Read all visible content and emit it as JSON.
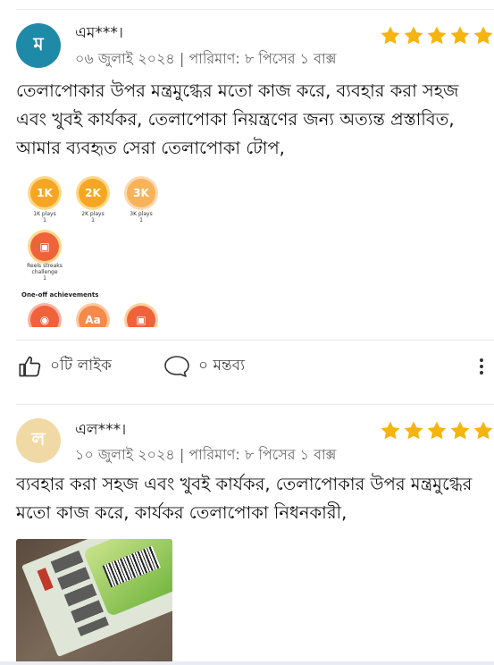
{
  "reviews": [
    {
      "avatar_letter": "ম",
      "avatar_color": "#1f8aa8",
      "name": "এম***।",
      "meta": "০৬ জুলাই ২০২৪ | পারিমাণ: ৮ পিসের ১ বাক্স",
      "rating": 5,
      "text": "তেলাপোকার উপর মন্ত্রমুগ্ধের মতো কাজ করে, ব্যবহার করা সহজ এবং খুবই কার্যকর, তেলাপোকা নিয়ন্ত্রণের জন্য অত্যন্ত প্রস্তাবিত, আমার ব্যবহৃত সেরা তেলাপোকা টোপ,",
      "image": {
        "badges": [
          {
            "label": "1K",
            "caption": "1K plays",
            "count": "1"
          },
          {
            "label": "2K",
            "caption": "2K plays",
            "count": "1"
          },
          {
            "label": "3K",
            "caption": "3K plays",
            "count": "1"
          }
        ],
        "streak_caption": "Reels streaks challenge",
        "streak_count": "1",
        "section_title": "One-off achievements",
        "aa_label": "Aa"
      },
      "likes_label": "০টি লাইক",
      "comments_label": "০ মন্তব্য"
    },
    {
      "avatar_letter": "ল",
      "avatar_color": "#f1d9a6",
      "name": "এল***।",
      "meta": "১০ জুলাই ২০২৪ | পারিমাণ: ৮ পিসের ১ বাক্স",
      "rating": 5,
      "text": "ব্যবহার করা সহজ এবং খুবই কার্যকর, তেলাপোকার উপর মন্ত্রমুগ্ধের মতো কাজ করে, কার্যকর তেলাপোকা নিধনকারী,"
    }
  ],
  "colors": {
    "star": "#f5b50e",
    "text": "#111111",
    "meta": "#666666",
    "badge_orange": "#f5a623",
    "badge_red": "#f0623a"
  },
  "icons": {
    "like": "thumbs-up-icon",
    "comment": "speech-bubble-icon",
    "more": "vertical-ellipsis-icon",
    "rating": "star-icon"
  }
}
